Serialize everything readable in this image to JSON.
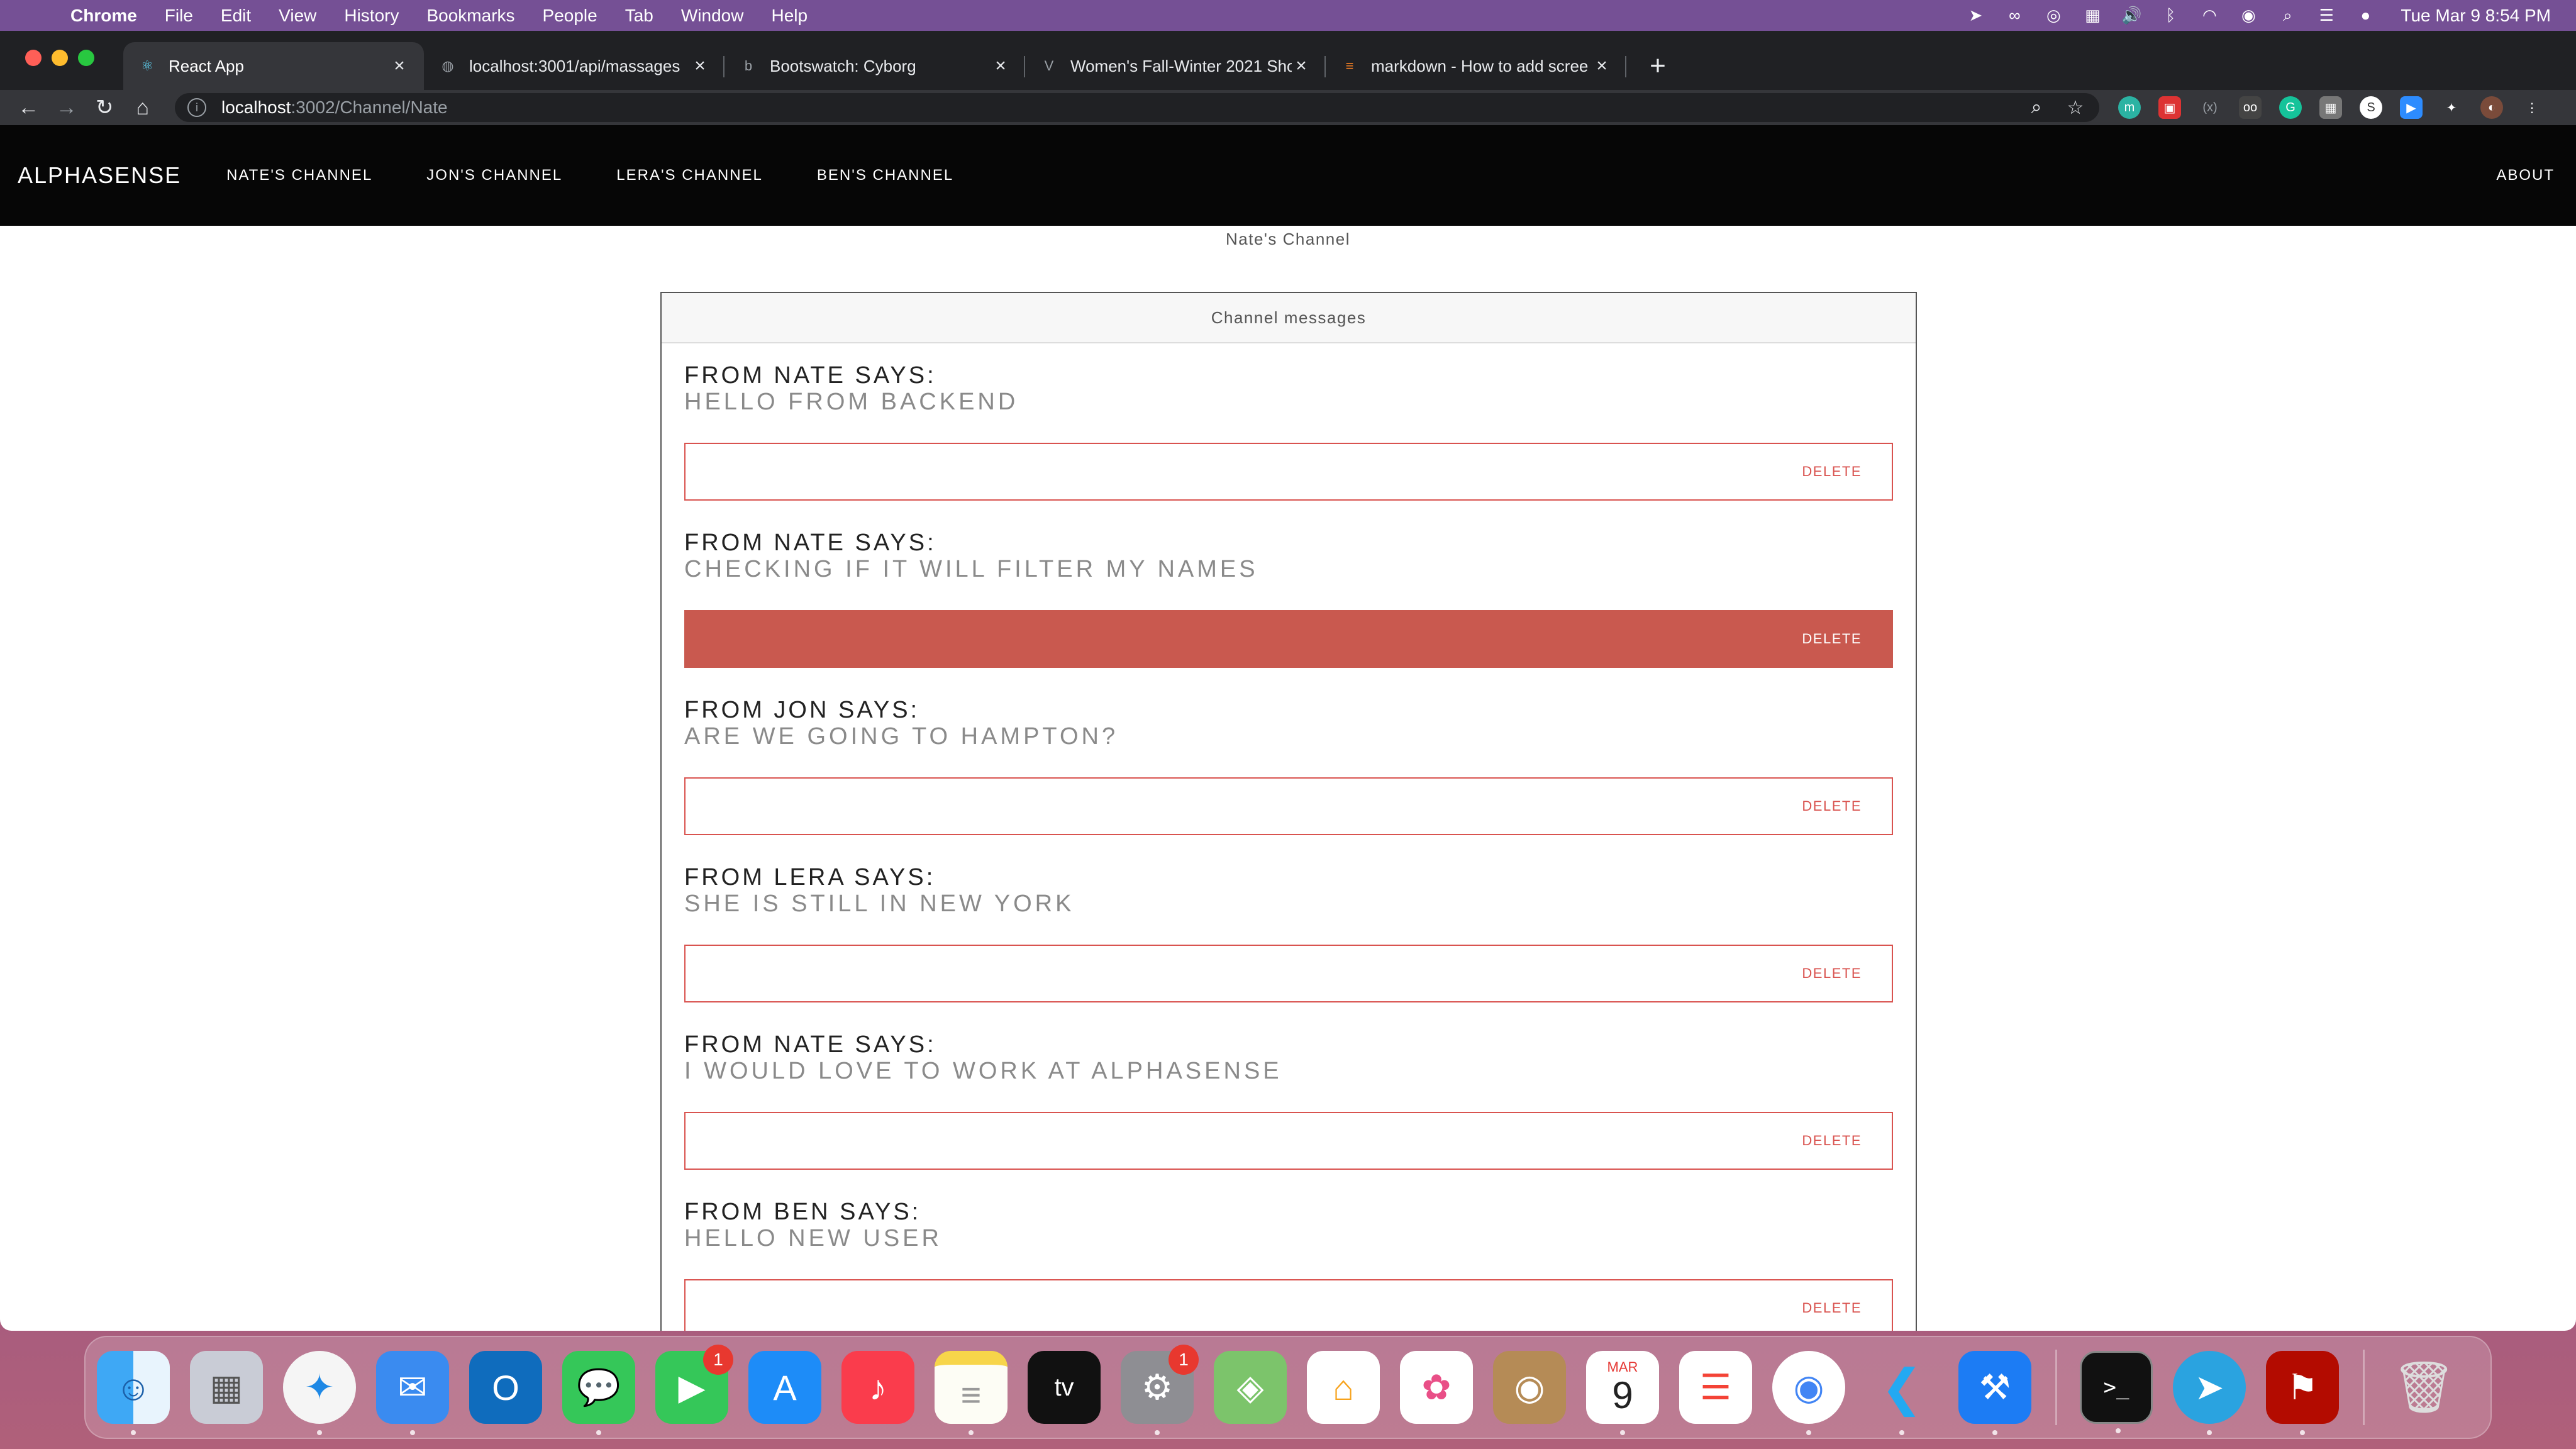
{
  "menubar": {
    "app_name": "Chrome",
    "items": [
      "File",
      "Edit",
      "View",
      "History",
      "Bookmarks",
      "People",
      "Tab",
      "Window",
      "Help"
    ],
    "clock": "Tue Mar 9  8:54 PM",
    "status_icons": [
      "telegram-icon",
      "creative-cloud-icon",
      "activity-icon",
      "magnet-icon",
      "volume-icon",
      "bluetooth-icon",
      "wifi-icon",
      "user-icon",
      "search-icon",
      "control-center-icon",
      "siri-icon"
    ]
  },
  "browser": {
    "tabs": [
      {
        "title": "React App",
        "favicon": "react-icon",
        "active": true
      },
      {
        "title": "localhost:3001/api/massages",
        "favicon": "globe-icon",
        "active": false
      },
      {
        "title": "Bootswatch: Cyborg",
        "favicon": "bootstrap-icon",
        "active": false
      },
      {
        "title": "Women's Fall-Winter 2021 Sho",
        "favicon": "lv-icon",
        "active": false
      },
      {
        "title": "markdown - How to add scree",
        "favicon": "stackoverflow-icon",
        "active": false
      }
    ],
    "url_host": "localhost",
    "url_path": ":3002/Channel/Nate"
  },
  "app": {
    "brand": "ALPHASENSE",
    "nav": [
      "NATE'S CHANNEL",
      "JON'S CHANNEL",
      "LERA'S CHANNEL",
      "BEN'S CHANNEL"
    ],
    "about": "ABOUT",
    "channel_title": "Nate's Channel",
    "card_header": "Channel messages",
    "delete_label": "DELETE",
    "messages": [
      {
        "from": "FROM NATE SAYS:",
        "text": "HELLO FROM BACKEND"
      },
      {
        "from": "FROM NATE SAYS:",
        "text": "CHECKING IF IT WILL FILTER MY NAMES"
      },
      {
        "from": "FROM JON SAYS:",
        "text": "ARE WE GOING TO HAMPTON?"
      },
      {
        "from": "FROM LERA SAYS:",
        "text": "SHE IS STILL IN NEW YORK"
      },
      {
        "from": "FROM NATE SAYS:",
        "text": "I WOULD LOVE TO WORK AT ALPHASENSE"
      },
      {
        "from": "FROM BEN SAYS:",
        "text": "HELLO NEW USER"
      }
    ]
  },
  "dock": {
    "calendar_month": "MAR",
    "calendar_day": "9",
    "facetime_badge": "1",
    "settings_badge": "1"
  },
  "colors": {
    "danger": "#d9534f",
    "danger_filled": "#c9594f",
    "navbar_bg": "#060606"
  }
}
